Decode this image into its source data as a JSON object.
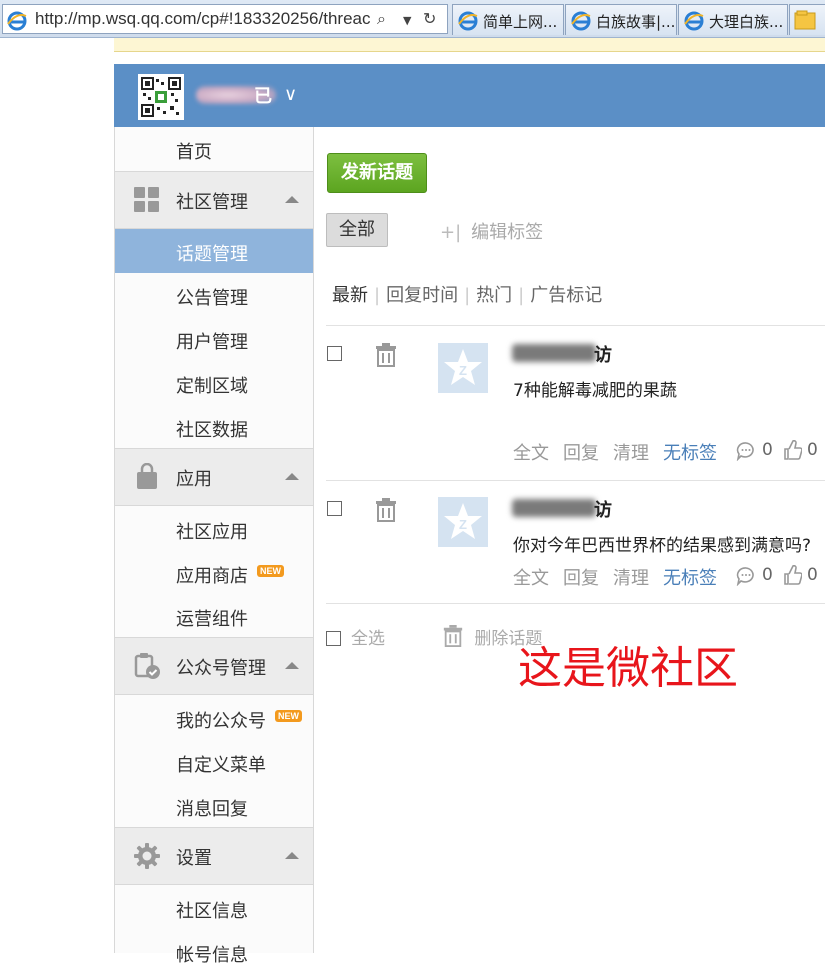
{
  "browser": {
    "url": "http://mp.wsq.qq.com/cp#!183320256/threac",
    "tabs": [
      "简单上网...",
      "白族故事|...",
      "大理白族..."
    ]
  },
  "header": {
    "account_name_visible": "已"
  },
  "sidebar": {
    "home": "首页",
    "groups": [
      {
        "label": "社区管理",
        "items": [
          "话题管理",
          "公告管理",
          "用户管理",
          "定制区域",
          "社区数据"
        ]
      },
      {
        "label": "应用",
        "items": [
          "社区应用",
          "应用商店",
          "运营组件"
        ]
      },
      {
        "label": "公众号管理",
        "items": [
          "我的公众号",
          "自定义菜单",
          "消息回复"
        ]
      },
      {
        "label": "设置",
        "items": [
          "社区信息",
          "帐号信息"
        ]
      }
    ],
    "new_badge": "NEW"
  },
  "main": {
    "new_topic_button": "发新话题",
    "filter_all": "全部",
    "edit_tags": "编辑标签",
    "sort_tabs": [
      "最新",
      "回复时间",
      "热门",
      "广告标记"
    ],
    "posts": [
      {
        "author_tail": "访",
        "title": "7种能解毒减肥的果蔬",
        "actions": [
          "全文",
          "回复",
          "清理",
          "无标签"
        ],
        "comments": "0",
        "likes": "0"
      },
      {
        "author_tail": "访",
        "title": "你对今年巴西世界杯的结果感到满意吗?",
        "actions": [
          "全文",
          "回复",
          "清理",
          "无标签"
        ],
        "comments": "0",
        "likes": "0"
      }
    ],
    "select_all": "全选",
    "delete_topics": "删除话题",
    "annotation": "这是微社区"
  },
  "colors": {
    "header_blue": "#5b8fc6",
    "active_item": "#8fb4dc",
    "green_button": "#5ca520",
    "annotation_red": "#e8151b"
  }
}
